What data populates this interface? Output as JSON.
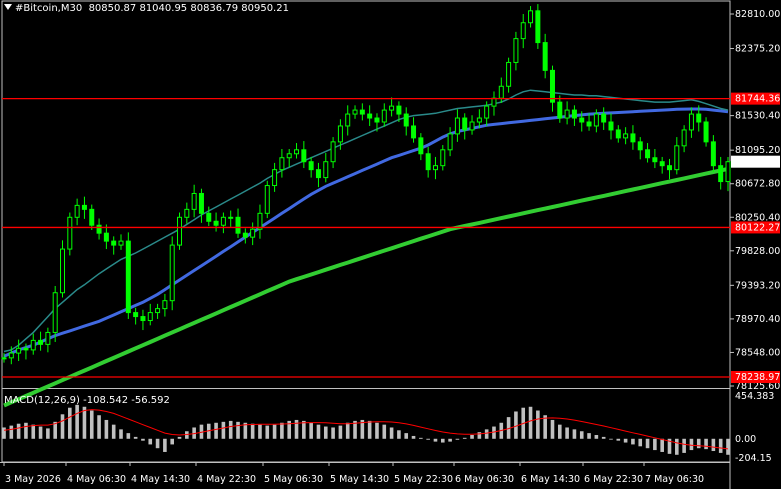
{
  "header": {
    "symbol": "#Bitcoin,M30",
    "ohlc": "80850.87 81040.95 80836.79 80950.21"
  },
  "price_axis": {
    "labels": [
      "82810.00",
      "82375.20",
      "81530.40",
      "81095.20",
      "80672.80",
      "80250.40",
      "79828.00",
      "79393.20",
      "78970.40",
      "78548.00",
      "78125.60"
    ],
    "current_price": "80950.21",
    "levels": [
      {
        "label": "81744.36",
        "color": "#ff0000"
      },
      {
        "label": "80122.27",
        "color": "#ff0000"
      },
      {
        "label": "78238.97",
        "color": "#ff0000"
      }
    ]
  },
  "time_axis": [
    "3 May 2026",
    "4 May 06:30",
    "4 May 14:30",
    "4 May 22:30",
    "5 May 06:30",
    "5 May 14:30",
    "5 May 22:30",
    "6 May 06:30",
    "6 May 14:30",
    "6 May 22:30",
    "7 May 06:30"
  ],
  "macd": {
    "label": "MACD(12,26,9) -108.542 -56.592",
    "axis_labels": [
      "454.383",
      "0.00",
      "-204.15"
    ]
  },
  "colors": {
    "background": "#000000",
    "candle": "#00ff00",
    "ma_fast": "#2a8a8a",
    "ma_mid": "#4169e1",
    "ma_slow": "#32cd32",
    "level": "#ff0000",
    "macd_hist": "#c0c0c0",
    "macd_signal": "#ff0000"
  },
  "chart_data": {
    "type": "line",
    "title": "#Bitcoin,M30",
    "ylim": [
      78125.6,
      82810.0
    ],
    "price_series": [
      78480,
      78540,
      78600,
      78580,
      78700,
      78650,
      78800,
      79300,
      79850,
      80250,
      80400,
      80350,
      80150,
      80050,
      79950,
      79900,
      79950,
      79050,
      79000,
      78950,
      79050,
      79100,
      79200,
      79900,
      80250,
      80350,
      80550,
      80300,
      80200,
      80150,
      80250,
      80250,
      80050,
      80000,
      80100,
      80300,
      80650,
      80850,
      81000,
      81050,
      81100,
      80950,
      80850,
      80750,
      80950,
      81200,
      81400,
      81550,
      81600,
      81550,
      81500,
      81450,
      81600,
      81650,
      81550,
      81400,
      81250,
      81050,
      80850,
      80900,
      81100,
      81300,
      81500,
      81350,
      81450,
      81500,
      81650,
      81750,
      81900,
      82200,
      82500,
      82700,
      82850,
      82450,
      82100,
      81700,
      81500,
      81600,
      81500,
      81450,
      81400,
      81550,
      81450,
      81350,
      81250,
      81300,
      81200,
      81100,
      81000,
      80950,
      80900,
      80850,
      81150,
      81350,
      81550,
      81450,
      81200,
      80900,
      80700,
      80950
    ],
    "ma_fast": [
      78560,
      78580,
      78640,
      78720,
      78800,
      78900,
      79000,
      79100,
      79180,
      79260,
      79340,
      79400,
      79470,
      79540,
      79600,
      79660,
      79720,
      79760,
      79800,
      79850,
      79900,
      79950,
      80000,
      80050,
      80100,
      80160,
      80220,
      80280,
      80330,
      80380,
      80430,
      80480,
      80530,
      80580,
      80630,
      80680,
      80740,
      80790,
      80840,
      80880,
      80920,
      80960,
      81000,
      81040,
      81080,
      81120,
      81160,
      81200,
      81240,
      81280,
      81320,
      81360,
      81400,
      81440,
      81480,
      81510,
      81530,
      81540,
      81550,
      81560,
      81580,
      81600,
      81620,
      81630,
      81640,
      81650,
      81660,
      81680,
      81700,
      81740,
      81790,
      81830,
      81850,
      81840,
      81830,
      81820,
      81810,
      81800,
      81790,
      81790,
      81780,
      81780,
      81770,
      81760,
      81750,
      81740,
      81730,
      81720,
      81710,
      81700,
      81700,
      81700,
      81710,
      81720,
      81730,
      81710,
      81680,
      81650,
      81620,
      81600
    ],
    "ma_mid": [
      78500,
      78540,
      78580,
      78610,
      78640,
      78680,
      78720,
      78760,
      78790,
      78820,
      78850,
      78880,
      78910,
      78940,
      78980,
      79020,
      79060,
      79100,
      79140,
      79180,
      79230,
      79280,
      79340,
      79400,
      79460,
      79520,
      79580,
      79640,
      79700,
      79760,
      79820,
      79880,
      79940,
      80000,
      80060,
      80120,
      80180,
      80240,
      80300,
      80360,
      80420,
      80480,
      80540,
      80590,
      80640,
      80680,
      80720,
      80760,
      80800,
      80840,
      80880,
      80920,
      80960,
      81000,
      81030,
      81060,
      81090,
      81120,
      81160,
      81210,
      81260,
      81300,
      81330,
      81350,
      81370,
      81390,
      81410,
      81420,
      81430,
      81440,
      81450,
      81460,
      81470,
      81480,
      81490,
      81500,
      81510,
      81520,
      81530,
      81540,
      81550,
      81555,
      81560,
      81565,
      81570,
      81575,
      81580,
      81585,
      81590,
      81595,
      81600,
      81605,
      81610,
      81612,
      81614,
      81614,
      81610,
      81600,
      81590,
      81580
    ],
    "ma_slow": [
      77880,
      77920,
      77960,
      78000,
      78040,
      78080,
      78120,
      78160,
      78200,
      78240,
      78280,
      78320,
      78360,
      78400,
      78440,
      78480,
      78520,
      78560,
      78600,
      78640,
      78680,
      78720,
      78760,
      78800,
      78840,
      78880,
      78920,
      78960,
      79000,
      79040,
      79080,
      79120,
      79160,
      79200,
      79240,
      79280,
      79320,
      79360,
      79400,
      79440,
      79470,
      79500,
      79530,
      79560,
      79590,
      79620,
      79650,
      79680,
      79710,
      79740,
      79770,
      79800,
      79830,
      79860,
      79890,
      79920,
      79950,
      79980,
      80010,
      80040,
      80070,
      80100,
      80120,
      80140,
      80160,
      80180,
      80200,
      80220,
      80240,
      80260,
      80280,
      80300,
      80320,
      80340,
      80360,
      80380,
      80400,
      80420,
      80440,
      80460,
      80480,
      80500,
      80520,
      80540,
      80560,
      80580,
      80600,
      80620,
      80640,
      80660,
      80680,
      80700,
      80720,
      80740,
      80760,
      80780,
      80800,
      80820,
      80840,
      80860
    ],
    "macd_hist": [
      120,
      140,
      160,
      170,
      150,
      130,
      110,
      180,
      260,
      330,
      360,
      340,
      300,
      250,
      200,
      150,
      100,
      60,
      20,
      -20,
      -60,
      -100,
      -140,
      -60,
      20,
      80,
      120,
      150,
      160,
      170,
      180,
      190,
      180,
      170,
      160,
      150,
      140,
      150,
      170,
      190,
      200,
      190,
      170,
      150,
      130,
      120,
      140,
      170,
      190,
      200,
      190,
      170,
      150,
      120,
      90,
      60,
      30,
      10,
      -10,
      -30,
      -40,
      -30,
      -10,
      10,
      40,
      70,
      100,
      130,
      170,
      230,
      290,
      330,
      340,
      300,
      250,
      200,
      150,
      120,
      100,
      80,
      60,
      40,
      20,
      0,
      -20,
      -40,
      -60,
      -80,
      -100,
      -120,
      -140,
      -160,
      -170,
      -150,
      -120,
      -100,
      -110,
      -130,
      -150,
      -170
    ],
    "macd_signal": [
      90,
      100,
      115,
      130,
      140,
      145,
      145,
      160,
      190,
      230,
      270,
      300,
      310,
      305,
      290,
      270,
      240,
      210,
      180,
      150,
      120,
      90,
      60,
      45,
      40,
      45,
      55,
      70,
      85,
      100,
      115,
      130,
      140,
      148,
      152,
      154,
      155,
      155,
      157,
      160,
      165,
      170,
      172,
      172,
      170,
      165,
      160,
      160,
      165,
      172,
      178,
      180,
      180,
      178,
      170,
      158,
      142,
      124,
      106,
      88,
      72,
      60,
      52,
      48,
      48,
      52,
      60,
      72,
      88,
      108,
      134,
      162,
      190,
      210,
      220,
      222,
      218,
      210,
      198,
      184,
      168,
      152,
      136,
      118,
      100,
      82,
      64,
      46,
      28,
      10,
      -8,
      -26,
      -44,
      -58,
      -68,
      -74,
      -80,
      -88,
      -98,
      -108
    ]
  }
}
